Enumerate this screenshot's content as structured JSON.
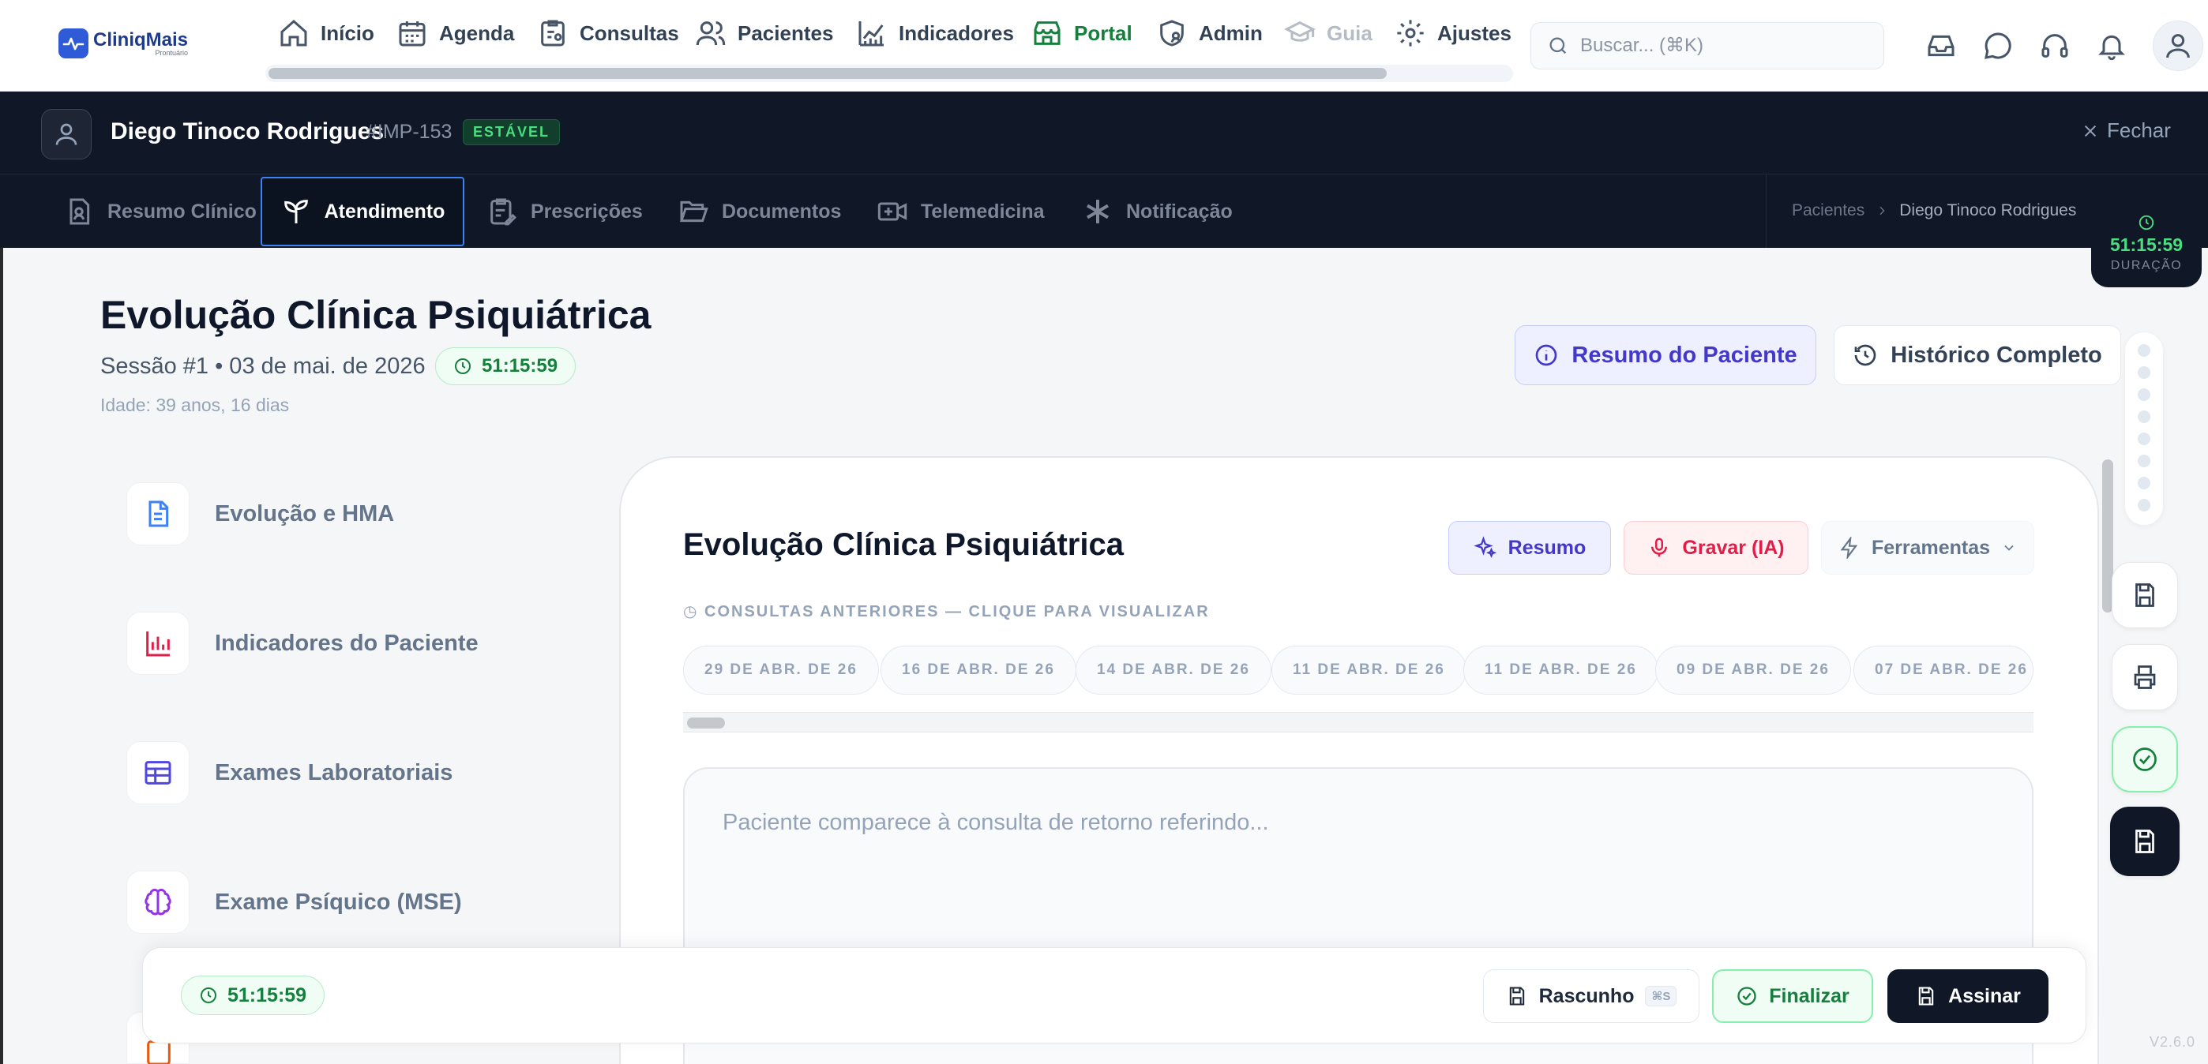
{
  "app": {
    "logo_text": "CliniqMais",
    "logo_sub": "Prontuário"
  },
  "nav": {
    "items": [
      {
        "label": "Início",
        "icon": "home-icon"
      },
      {
        "label": "Agenda",
        "icon": "calendar-icon"
      },
      {
        "label": "Consultas",
        "icon": "clipboard-user-icon"
      },
      {
        "label": "Pacientes",
        "icon": "users-icon"
      },
      {
        "label": "Indicadores",
        "icon": "chart-line-icon"
      },
      {
        "label": "Portal",
        "icon": "store-icon"
      },
      {
        "label": "Admin",
        "icon": "shield-user-icon"
      },
      {
        "label": "Guia",
        "icon": "graduation-cap-icon"
      },
      {
        "label": "Ajustes",
        "icon": "gear-icon"
      }
    ],
    "search_placeholder": "Buscar... (⌘K)"
  },
  "patient": {
    "name": "Diego Tinoco Rodrigues",
    "id": "#IMP-153",
    "status": "ESTÁVEL",
    "close_label": "Fechar"
  },
  "tabs": [
    {
      "label": "Resumo Clínico"
    },
    {
      "label": "Atendimento"
    },
    {
      "label": "Prescrições"
    },
    {
      "label": "Documentos"
    },
    {
      "label": "Telemedicina"
    },
    {
      "label": "Notificação"
    }
  ],
  "breadcrumb": [
    "Pacientes",
    "Diego Tinoco Rodrigues"
  ],
  "duration": {
    "time": "51:15:59",
    "label": "DURAÇÃO"
  },
  "page": {
    "title": "Evolução Clínica Psiquiátrica",
    "session": "Sessão #1 • 03 de mai. de 2026",
    "timer": "51:15:59",
    "age": "Idade: 39 anos, 16 dias",
    "resumo_paciente": "Resumo do Paciente",
    "historico": "Histórico Completo"
  },
  "sections": [
    {
      "label": "Evolução e HMA"
    },
    {
      "label": "Indicadores do Paciente"
    },
    {
      "label": "Exames Laboratoriais"
    },
    {
      "label": "Exame Psíquico (MSE)"
    }
  ],
  "card": {
    "title": "Evolução Clínica Psiquiátrica",
    "btn_resumo": "Resumo",
    "btn_gravar": "Gravar (IA)",
    "btn_ferramentas": "Ferramentas",
    "prev_label": "◷ CONSULTAS ANTERIORES — CLIQUE PARA VISUALIZAR",
    "dates": [
      "29 DE ABR. DE 26",
      "16 DE ABR. DE 26",
      "14 DE ABR. DE 26",
      "11 DE ABR. DE 26",
      "11 DE ABR. DE 26",
      "09 DE ABR. DE 26",
      "07 DE ABR. DE 26"
    ],
    "editor_placeholder": "Paciente comparece à consulta de retorno referindo..."
  },
  "footer": {
    "timer": "51:15:59",
    "rascunho": "Rascunho",
    "shortcut": "⌘S",
    "finalizar": "Finalizar",
    "assinar": "Assinar"
  },
  "version": "V2.6.0"
}
